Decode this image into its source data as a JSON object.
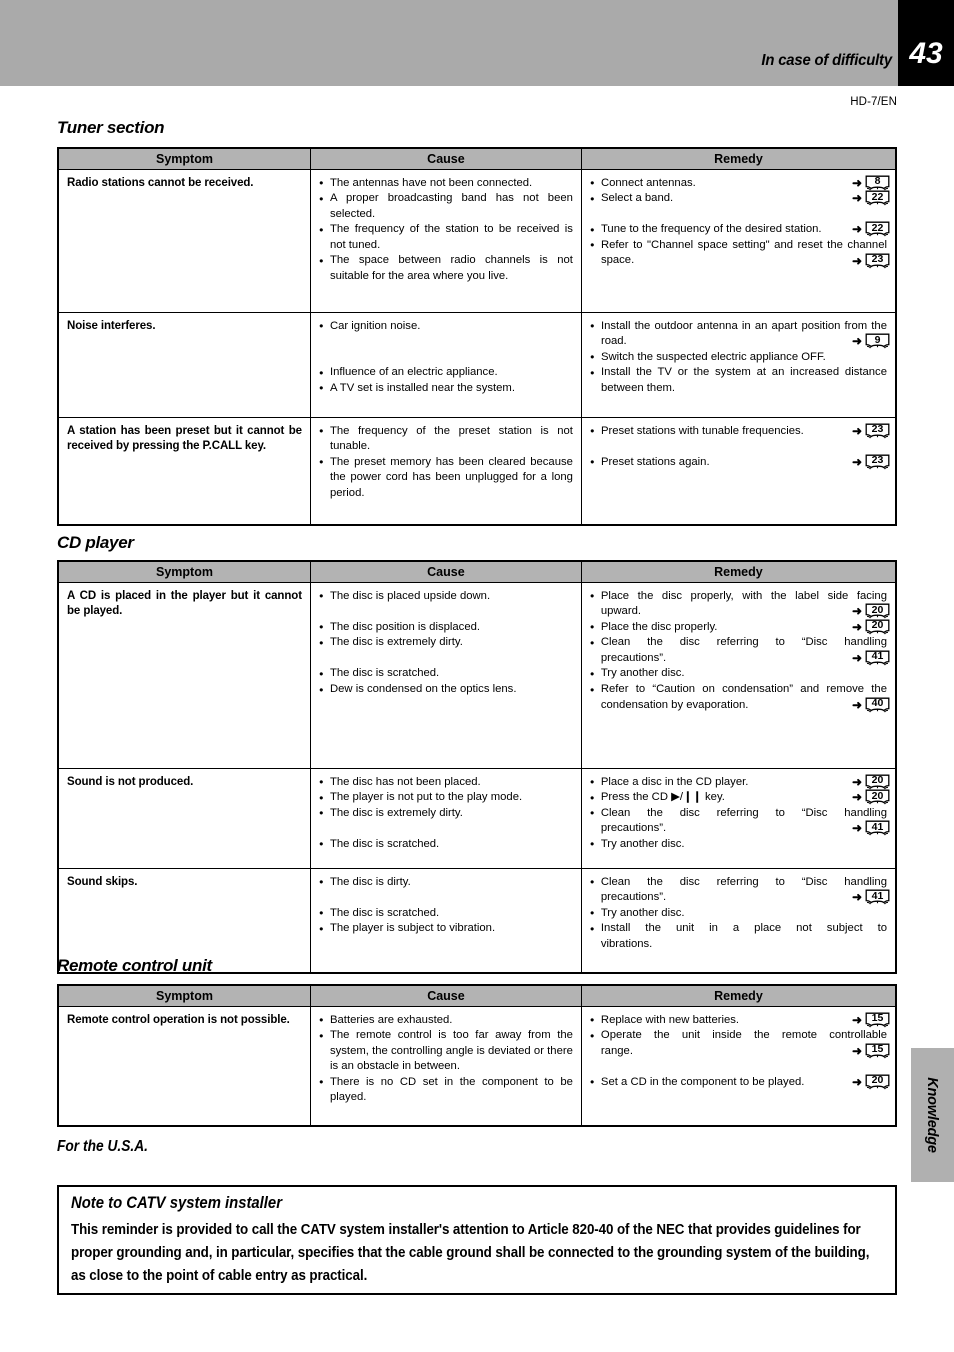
{
  "header": {
    "title": "In case of difficulty",
    "page_number": "43",
    "model_code": "HD-7/EN"
  },
  "columns": [
    "Symptom",
    "Cause",
    "Remedy"
  ],
  "sections": [
    {
      "heading": "Tuner section",
      "rows": [
        {
          "symptom": "Radio stations cannot be received.",
          "causes": [
            {
              "text": "The antennas have not been connected."
            },
            {
              "text": "A proper broadcasting band has not been selected."
            },
            {
              "text": "The frequency of the station to be received is not tuned."
            },
            {
              "text": "The space between radio channels is not suitable for the area where you live."
            }
          ],
          "remedies": [
            {
              "text": "Connect antennas.",
              "page": "8"
            },
            {
              "text": "Select a band.",
              "page": "22"
            },
            {
              "text": "Tune to the frequency of the desired station.",
              "page": "22",
              "gap": true
            },
            {
              "text": "Refer to \"Channel space setting\" and reset the channel space.",
              "page": "23"
            }
          ]
        },
        {
          "symptom": "Noise interferes.",
          "causes": [
            {
              "text": "Car ignition noise."
            },
            {
              "text": "Influence of an electric appliance.",
              "gap2": true
            },
            {
              "text": "A TV set is installed near the system."
            }
          ],
          "remedies": [
            {
              "text": "Install the outdoor antenna in an apart position from the road.",
              "page": "9"
            },
            {
              "text": "Switch the suspected electric appliance OFF."
            },
            {
              "text": "Install the TV or the system at an increased distance between them."
            }
          ]
        },
        {
          "symptom": "A station has been preset but it cannot be received by pressing the P.CALL key.",
          "causes": [
            {
              "text": "The frequency of the preset station is not tunable."
            },
            {
              "text": "The preset memory has been cleared because the power cord has been unplugged for a long period."
            }
          ],
          "remedies": [
            {
              "text": "Preset stations with tunable frequencies.",
              "page": "23"
            },
            {
              "text": "Preset stations again.",
              "page": "23",
              "gap": true
            }
          ]
        }
      ]
    },
    {
      "heading": "CD player",
      "rows": [
        {
          "symptom": "A CD is placed in the player but it cannot be played.",
          "causes": [
            {
              "text": "The disc is placed upside down."
            },
            {
              "text": "The disc position is displaced.",
              "gap": true
            },
            {
              "text": "The disc is extremely dirty."
            },
            {
              "text": "The disc is scratched.",
              "gap": true
            },
            {
              "text": "Dew is condensed on the optics lens."
            }
          ],
          "remedies": [
            {
              "text": "Place the disc properly, with the label side facing upward.",
              "page": "20"
            },
            {
              "text": "Place the disc properly.",
              "page": "20"
            },
            {
              "text": "Clean the disc referring to “Disc handling precautions”.",
              "page": "41"
            },
            {
              "text": "Try another disc."
            },
            {
              "text": "Refer to “Caution on condensation” and remove the condensation by evaporation.",
              "page": "40"
            }
          ]
        },
        {
          "symptom": "Sound is not produced.",
          "causes": [
            {
              "text": "The disc has not been placed."
            },
            {
              "text": "The player is not put to the play mode."
            },
            {
              "text": "The disc is extremely dirty."
            },
            {
              "text": "The disc is scratched.",
              "gap": true
            }
          ],
          "remedies": [
            {
              "text": "Place a disc in the CD player.",
              "page": "20"
            },
            {
              "text": "Press the CD ▶/❙❙ key.",
              "page": "20"
            },
            {
              "text": "Clean the disc referring to “Disc handling precautions”.",
              "page": "41"
            },
            {
              "text": "Try another disc."
            }
          ]
        },
        {
          "symptom": "Sound skips.",
          "causes": [
            {
              "text": "The disc is dirty."
            },
            {
              "text": "The disc is scratched.",
              "gap": true
            },
            {
              "text": "The player is subject to vibration."
            }
          ],
          "remedies": [
            {
              "text": "Clean the disc referring to “Disc handling precautions”.",
              "page": "41"
            },
            {
              "text": "Try another disc."
            },
            {
              "text": "Install the unit in a place not subject to vibrations."
            }
          ]
        }
      ]
    },
    {
      "heading": "Remote control unit",
      "rows": [
        {
          "symptom": "Remote control operation is not possible.",
          "causes": [
            {
              "text": "Batteries are exhausted."
            },
            {
              "text": "The remote control is too far away from the system, the controlling angle is deviated or there is an obstacle in between."
            },
            {
              "text": "There is no CD set in the component to be played."
            }
          ],
          "remedies": [
            {
              "text": "Replace with new batteries.",
              "page": "15"
            },
            {
              "text": "Operate the unit inside the remote controllable range.",
              "page": "15"
            },
            {
              "text": "Set a CD in the component to be played.",
              "page": "20",
              "gap": true
            }
          ]
        }
      ]
    }
  ],
  "usa": {
    "heading": "For the U.S.A.",
    "notice_title": "Note to CATV system installer",
    "notice_body": "This reminder is provided to call the CATV system installer's attention to Article 820-40 of the NEC that provides guidelines for proper grounding and, in particular, specifies that the cable ground shall be connected to the grounding system of the building, as close to the point of cable entry as practical."
  },
  "side_tab": {
    "label": "Knowledge"
  },
  "colors": {
    "header_band": "#aaaaaa",
    "table_header": "#b3b3b3",
    "page_box": "#000000",
    "side_tab": "#b0b0b0"
  }
}
